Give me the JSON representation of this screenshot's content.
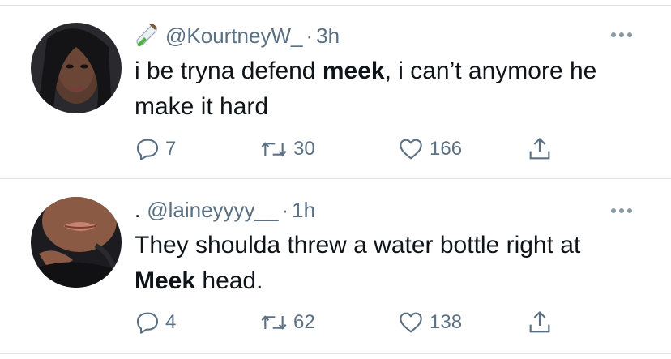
{
  "tweets": [
    {
      "handle": "@KourtneyW_",
      "separator": "·",
      "time": "3h",
      "lead": "",
      "text_before": "i be tryna defend ",
      "text_bold": "meek",
      "text_after": ", i can’t anymore he make it hard",
      "replies": "7",
      "retweets": "30",
      "likes": "166",
      "header_emoji": "test-tube-icon"
    },
    {
      "handle": "@laineyyyy__",
      "separator": "·",
      "time": "1h",
      "lead": ".",
      "text_before": "They shoulda threw a water bottle right at ",
      "text_bold": "Meek",
      "text_after": " head.",
      "replies": "4",
      "retweets": "62",
      "likes": "138"
    }
  ],
  "colors": {
    "secondary": "#5b7083",
    "text": "#0f1419",
    "divider": "#dfe3e6",
    "accent_green": "#44a04b"
  }
}
